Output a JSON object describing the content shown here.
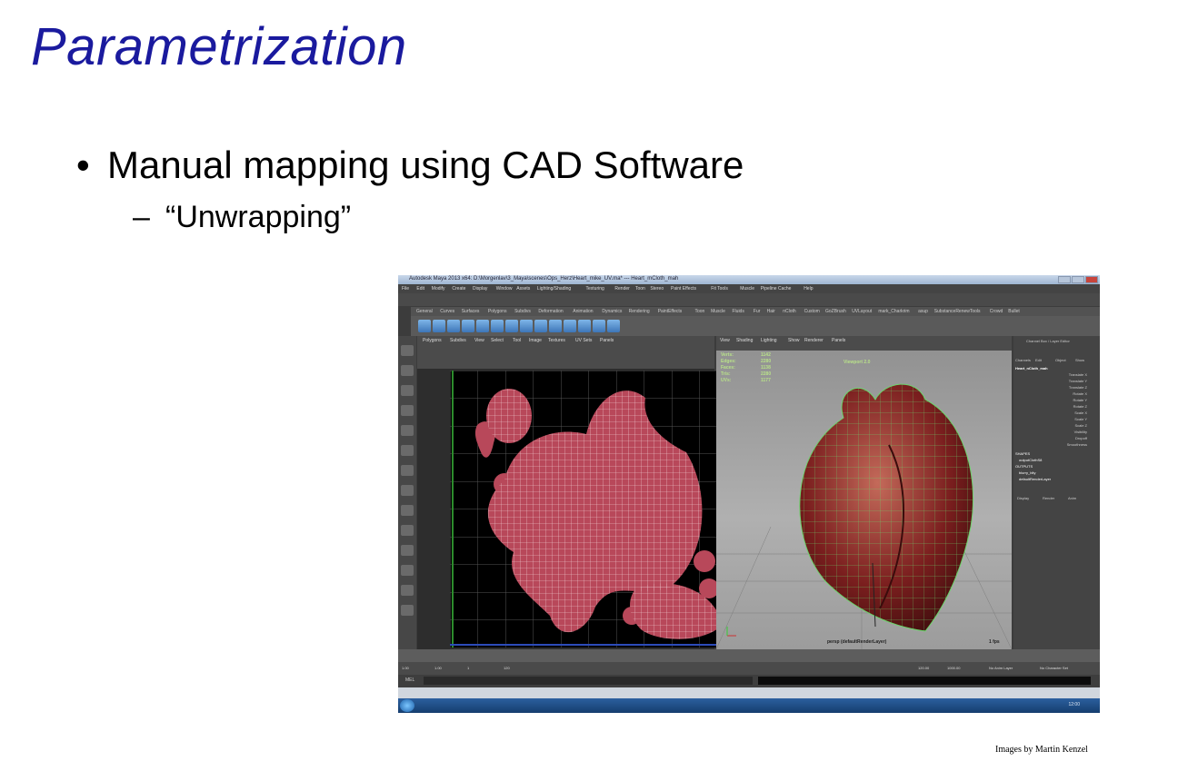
{
  "slide": {
    "title": "Parametrization",
    "bullet_1": "Manual mapping using CAD Software",
    "bullet_2": "“Unwrapping”",
    "credit": "Images by Martin Kenzel"
  },
  "bullets": {
    "dot": "•",
    "dash": "–"
  },
  "screenshot": {
    "window_title": "Autodesk Maya 2013 x64: D:\\Morgenlav\\3_Maya\\scenes\\Ops_Herz\\Heart_mike_UV.ma* --- Heart_mCloth_mah",
    "menu": [
      "File",
      "Edit",
      "Modify",
      "Create",
      "Display",
      "Window",
      "Assets",
      "Lighting/Shading",
      "Texturing",
      "Render",
      "Toon",
      "Stereo",
      "Paint Effects",
      "Fit Tools",
      "Muscle",
      "Pipeline Cache",
      "Help"
    ],
    "shelf_tabs": [
      "General",
      "Curves",
      "Surfaces",
      "Polygons",
      "Subdivs",
      "Deformation",
      "Animation",
      "Dynamics",
      "Rendering",
      "PaintEffects",
      "Toon",
      "Muscle",
      "Fluids",
      "Fur",
      "Hair",
      "nCloth",
      "Custom",
      "GoZBrush",
      "UVLayout",
      "mark_Charkrim",
      "asup",
      "SubstanceRenewTools",
      "Crowd",
      "Bullet"
    ],
    "uv_menu": [
      "Polygons",
      "Subdivs",
      "View",
      "Select",
      "Tool",
      "Image",
      "Textures",
      "UV Sets",
      "Panels"
    ],
    "persp_menu": [
      "View",
      "Shading",
      "Lighting",
      "Show",
      "Renderer",
      "Panels"
    ],
    "hud_labels": [
      "Verts:",
      "Edges:",
      "Faces:",
      "Tris:",
      "UVs:"
    ],
    "hud_values": [
      "1142",
      "2280",
      "1138",
      "2280",
      "1177"
    ],
    "viewport_label": "Viewport 2.0",
    "camera_label": "persp (defaultRenderLayer)",
    "fps": "1 fps",
    "channel_header": "Channel Box / Layer Editor",
    "channel_tabs": [
      "Channels",
      "Edit",
      "Object",
      "Show"
    ],
    "object_name": "Heart_nCloth_mah",
    "channels": [
      "Translate X",
      "Translate Y",
      "Translate Z",
      "Rotate X",
      "Rotate Y",
      "Rotate Z",
      "Scale X",
      "Scale Y",
      "Scale Z",
      "Visibility",
      "Dropoff",
      "Smoothness"
    ],
    "shapes_label": "SHAPES",
    "shape_item": "outputClothS8",
    "outputs_label": "OUTPUTS",
    "outputs": [
      "blurry_blty",
      "defaultRenderLayer"
    ],
    "layer_tabs": [
      "Display",
      "Render",
      "Anim"
    ],
    "range": [
      "1.00",
      "1.00",
      "1",
      "120",
      "120.00",
      "1000.00"
    ],
    "anim_layer": "No Anim Layer",
    "char_set": "No Character Set",
    "mel": "MEL",
    "clock": "12:00",
    "colors": {
      "title_blue": "#1a1a9e",
      "uv_mesh": "#c44b5a",
      "heart": "#7a1e1e",
      "wire": "#6cd36c"
    }
  }
}
